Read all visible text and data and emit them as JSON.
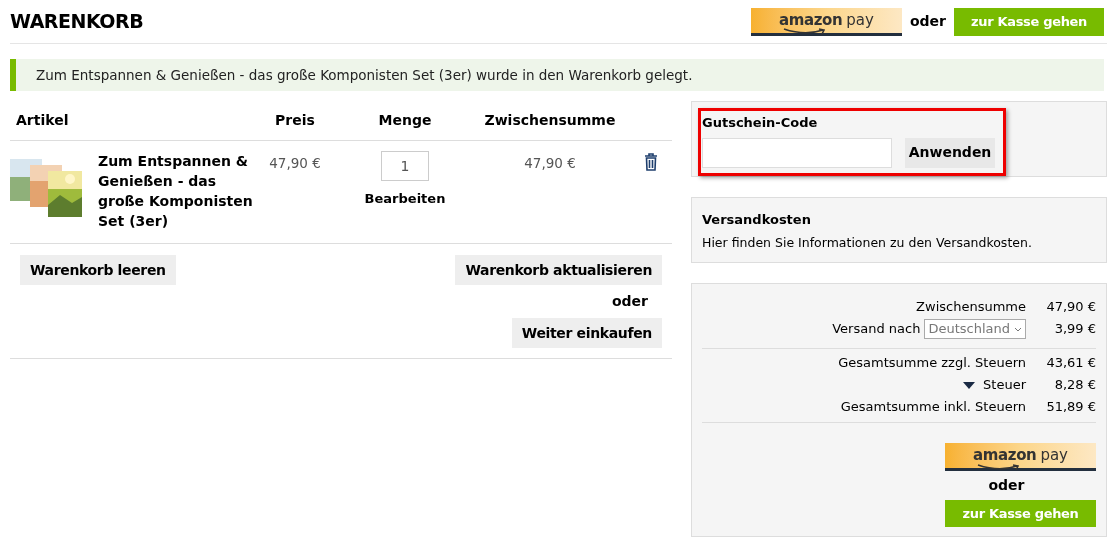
{
  "header": {
    "title": "WARENKORB",
    "amazon_pay": {
      "brand": "amazon",
      "suffix": "pay"
    },
    "or": "oder",
    "checkout": "zur Kasse gehen"
  },
  "notice": "Zum Entspannen & Genießen - das große Komponisten Set (3er) wurde in den Warenkorb gelegt.",
  "cart": {
    "columns": [
      "Artikel",
      "Preis",
      "Menge",
      "Zwischensumme"
    ],
    "items": [
      {
        "name": "Zum Entspannen & Genießen - das große Komponisten Set (3er)",
        "price": "47,90 €",
        "quantity": "1",
        "edit": "Bearbeiten",
        "subtotal": "47,90 €"
      }
    ],
    "clear": "Warenkorb leeren",
    "update": "Warenkorb aktualisieren",
    "or": "oder",
    "continue": "Weiter einkaufen"
  },
  "coupon": {
    "label": "Gutschein-Code",
    "apply": "Anwenden",
    "highlighted": true
  },
  "shipping_info": {
    "title": "Versandkosten",
    "text": "Hier finden Sie Informationen zu den Versandkosten."
  },
  "totals": {
    "rows": [
      {
        "kind": "plain",
        "label": "Zwischensumme",
        "value": "47,90 €"
      },
      {
        "kind": "country",
        "label": "Versand nach",
        "country": "Deutschland",
        "value": "3,99 €"
      },
      {
        "kind": "plain",
        "label": "Gesamtsumme zzgl. Steuern",
        "value": "43,61 €",
        "divider": true
      },
      {
        "kind": "toggle",
        "label": "Steuer",
        "value": "8,28 €"
      },
      {
        "kind": "plain",
        "label": "Gesamtsumme inkl. Steuern",
        "value": "51,89 €"
      }
    ],
    "amazon_pay": {
      "brand": "amazon",
      "suffix": "pay"
    },
    "or": "oder",
    "checkout": "zur Kasse gehen"
  }
}
